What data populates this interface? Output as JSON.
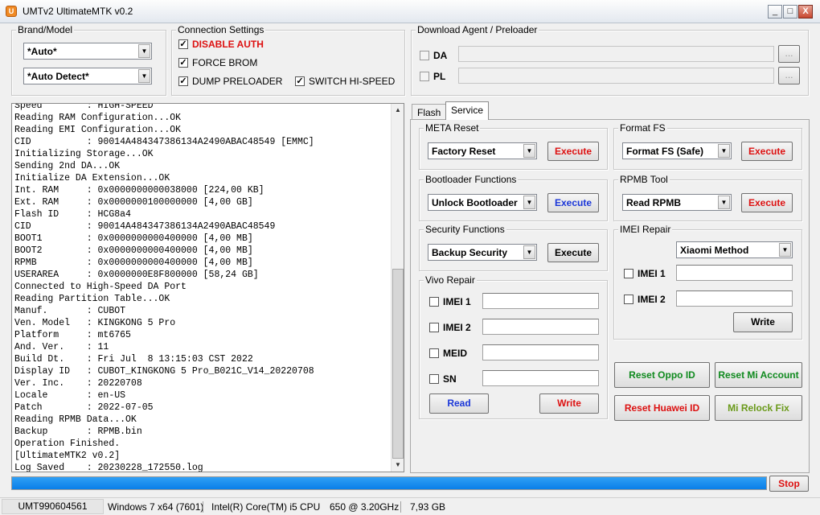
{
  "window": {
    "title": "UMTv2 UltimateMTK v0.2",
    "minimize": "_",
    "maximize": "□",
    "close": "X"
  },
  "brand_model": {
    "title": "Brand/Model",
    "brand_value": "*Auto*",
    "model_value": "*Auto Detect*"
  },
  "connection": {
    "title": "Connection Settings",
    "disable_auth": {
      "label": "DISABLE AUTH",
      "checked": true,
      "color": "#e02020"
    },
    "force_brom": {
      "label": "FORCE BROM",
      "checked": true
    },
    "dump_preloader": {
      "label": "DUMP PRELOADER",
      "checked": true
    },
    "switch_hi_speed": {
      "label": "SWITCH HI-SPEED",
      "checked": true
    }
  },
  "download_agent": {
    "title": "Download Agent / Preloader",
    "da_label": "DA",
    "pl_label": "PL",
    "browse_label": "..."
  },
  "log": {
    "lines": [
      "Speed        : HIGH-SPEED",
      "Reading RAM Configuration...OK",
      "Reading EMI Configuration...OK",
      "CID          : 90014A484347386134A2490ABAC48549 [EMMC]",
      "Initializing Storage...OK",
      "Sending 2nd DA...OK",
      "Initialize DA Extension...OK",
      "Int. RAM     : 0x0000000000038000 [224,00 KB]",
      "Ext. RAM     : 0x0000000100000000 [4,00 GB]",
      "Flash ID     : HCG8a4",
      "CID          : 90014A484347386134A2490ABAC48549",
      "BOOT1        : 0x0000000000400000 [4,00 MB]",
      "BOOT2        : 0x0000000000400000 [4,00 MB]",
      "RPMB         : 0x0000000000400000 [4,00 MB]",
      "USERAREA     : 0x0000000E8F800000 [58,24 GB]",
      "Connected to High-Speed DA Port",
      "Reading Partition Table...OK",
      "Manuf.       : CUBOT",
      "Ven. Model   : KINGKONG 5 Pro",
      "Platform     : mt6765",
      "And. Ver.    : 11",
      "Build Dt.    : Fri Jul  8 13:15:03 CST 2022",
      "Display ID   : CUBOT_KINGKONG 5 Pro_B021C_V14_20220708",
      "Ver. Inc.    : 20220708",
      "Locale       : en-US",
      "Patch        : 2022-07-05",
      "Reading RPMB Data...OK",
      "Backup       : RPMB.bin",
      "Operation Finished.",
      "[UltimateMTK2 v0.2]",
      "Log Saved    : 20230228_172550.log"
    ]
  },
  "tabs": [
    {
      "label": "Flash"
    },
    {
      "label": "Service"
    }
  ],
  "meta_reset": {
    "title": "META Reset",
    "option": "Factory Reset",
    "execute": "Execute"
  },
  "format_fs": {
    "title": "Format FS",
    "option": "Format FS (Safe)",
    "execute": "Execute"
  },
  "bootloader": {
    "title": "Bootloader Functions",
    "option": "Unlock Bootloader",
    "execute": "Execute"
  },
  "rpmb": {
    "title": "RPMB Tool",
    "option": "Read RPMB",
    "execute": "Execute"
  },
  "security": {
    "title": "Security Functions",
    "option": "Backup Security",
    "execute": "Execute"
  },
  "imei_repair": {
    "title": "IMEI Repair",
    "method": "Xiaomi Method",
    "imei1": "IMEI 1",
    "imei2": "IMEI 2",
    "write": "Write"
  },
  "vivo_repair": {
    "title": "Vivo Repair",
    "imei1": "IMEI 1",
    "imei2": "IMEI 2",
    "meid": "MEID",
    "sn": "SN",
    "read": "Read",
    "write": "Write"
  },
  "actions": {
    "reset_oppo": "Reset Oppo ID",
    "reset_mi": "Reset Mi Account",
    "reset_huawei": "Reset Huawei ID",
    "mi_relock": "Mi Relock Fix"
  },
  "progress": {
    "value": 1.0,
    "stop": "Stop"
  },
  "status": {
    "serial": "UMT990604561",
    "os": "Windows 7 x64 (7601)",
    "cpu": "Intel(R) Core(TM) i5 CPU",
    "cpu_speed": "650  @ 3.20GHz",
    "ram": "7,93 GB"
  },
  "colors": {
    "red": "#dd1111",
    "blue": "#1a36d8",
    "green": "#0f8a1e",
    "olive": "#6a9a1a",
    "progress": "#0a7fe8"
  }
}
